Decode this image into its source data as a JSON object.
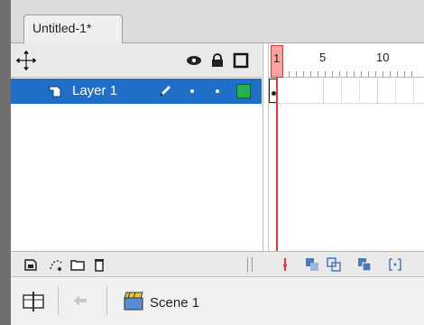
{
  "document_tab": {
    "title": "Untitled-1*"
  },
  "timeline": {
    "layers": [
      {
        "name": "Layer 1",
        "color": "#22b14c",
        "selected": true
      }
    ],
    "ruler_labels": [
      "1",
      "5",
      "10"
    ],
    "current_frame": 1,
    "icons": {
      "move": "move-cross-icon",
      "visibility": "eye-icon",
      "lock": "lock-icon",
      "outline": "outline-square-icon",
      "layer_type": "layer-page-icon",
      "edit": "pencil-icon"
    },
    "colors": {
      "selected_row": "#1f6fc8",
      "playhead": "#e33333",
      "layer_color": "#22b14c"
    }
  },
  "scene_bar": {
    "scene_label": "Scene 1"
  }
}
